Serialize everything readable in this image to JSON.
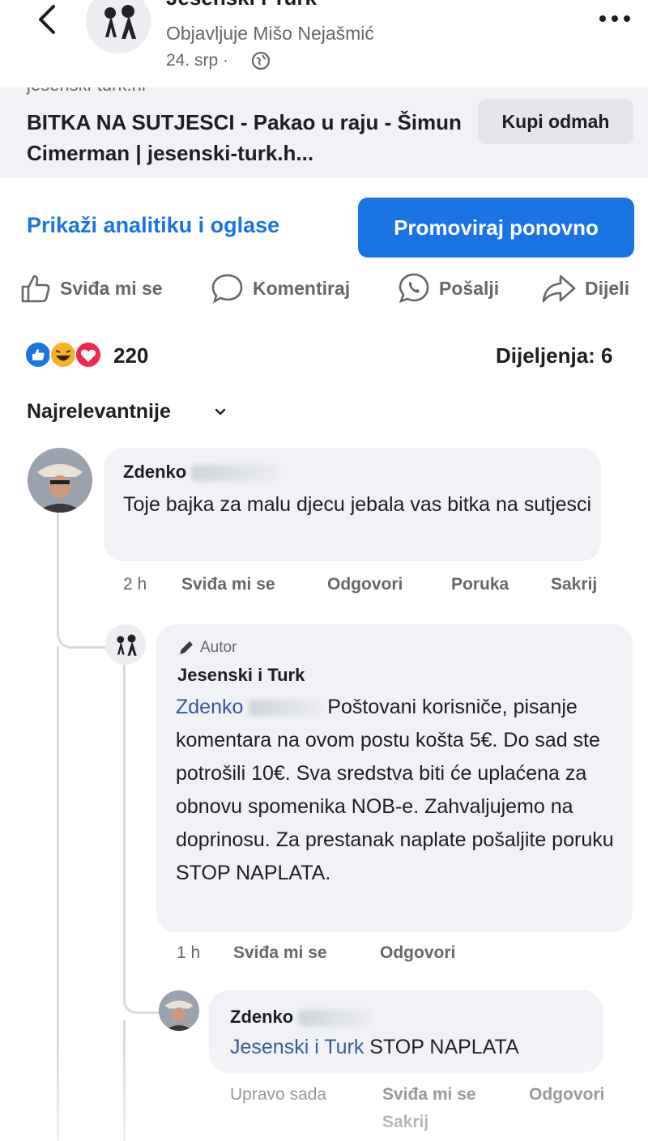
{
  "header": {
    "page_name": "Jesenski i Turk",
    "posted_by": "Objavljuje Mišo Nejašmić",
    "date": "24. srp ·",
    "icons": [
      "back-arrow-icon",
      "globe-icon",
      "more-icon"
    ]
  },
  "link_preview": {
    "domain": "jesenski-turk.hr",
    "title": "BITKA NA SUTJESCI - Pakao u raju - Šimun Cimerman | jesenski-turk.h...",
    "button_label": "Kupi odmah"
  },
  "promo": {
    "analytics_label": "Prikaži analitiku i oglase",
    "promote_label": "Promoviraj ponovno"
  },
  "actions": {
    "like": "Sviđa mi se",
    "comment": "Komentiraj",
    "send": "Pošalji",
    "share": "Dijeli"
  },
  "stats": {
    "reactions_count": "220",
    "shares": "Dijeljenja: 6"
  },
  "sort": {
    "label": "Najrelevantnije"
  },
  "comments": [
    {
      "author": "Zdenko",
      "text": "Toje bajka za malu djecu jebala vas bitka na sutjesci",
      "time": "2 h",
      "actions": [
        "Sviđa mi se",
        "Odgovori",
        "Poruka",
        "Sakrij"
      ]
    },
    {
      "badge": "Autor",
      "author": "Jesenski i Turk",
      "mention": "Zdenko",
      "text": "Poštovani korisniče, pisanje komentara na ovom postu košta 5€. Do sad ste potrošili 10€. Sva sredstva biti će uplaćena za obnovu spomenika NOB-e. Zahvaljujemo na doprinosu. Za prestanak naplate pošaljite poruku STOP NAPLATA.",
      "time": "1 h",
      "actions": [
        "Sviđa mi se",
        "Odgovori"
      ]
    },
    {
      "author": "Zdenko",
      "mention": "Jesenski i Turk",
      "text": "STOP NAPLATA",
      "time": "Upravo sada",
      "actions": [
        "Sviđa mi se",
        "Odgovori",
        "Sakrij"
      ]
    }
  ],
  "colors": {
    "accent_blue": "#1b74e4",
    "link_blue": "#385898",
    "bubble_gray": "#f0f2f5",
    "meta_gray": "#65676b"
  }
}
